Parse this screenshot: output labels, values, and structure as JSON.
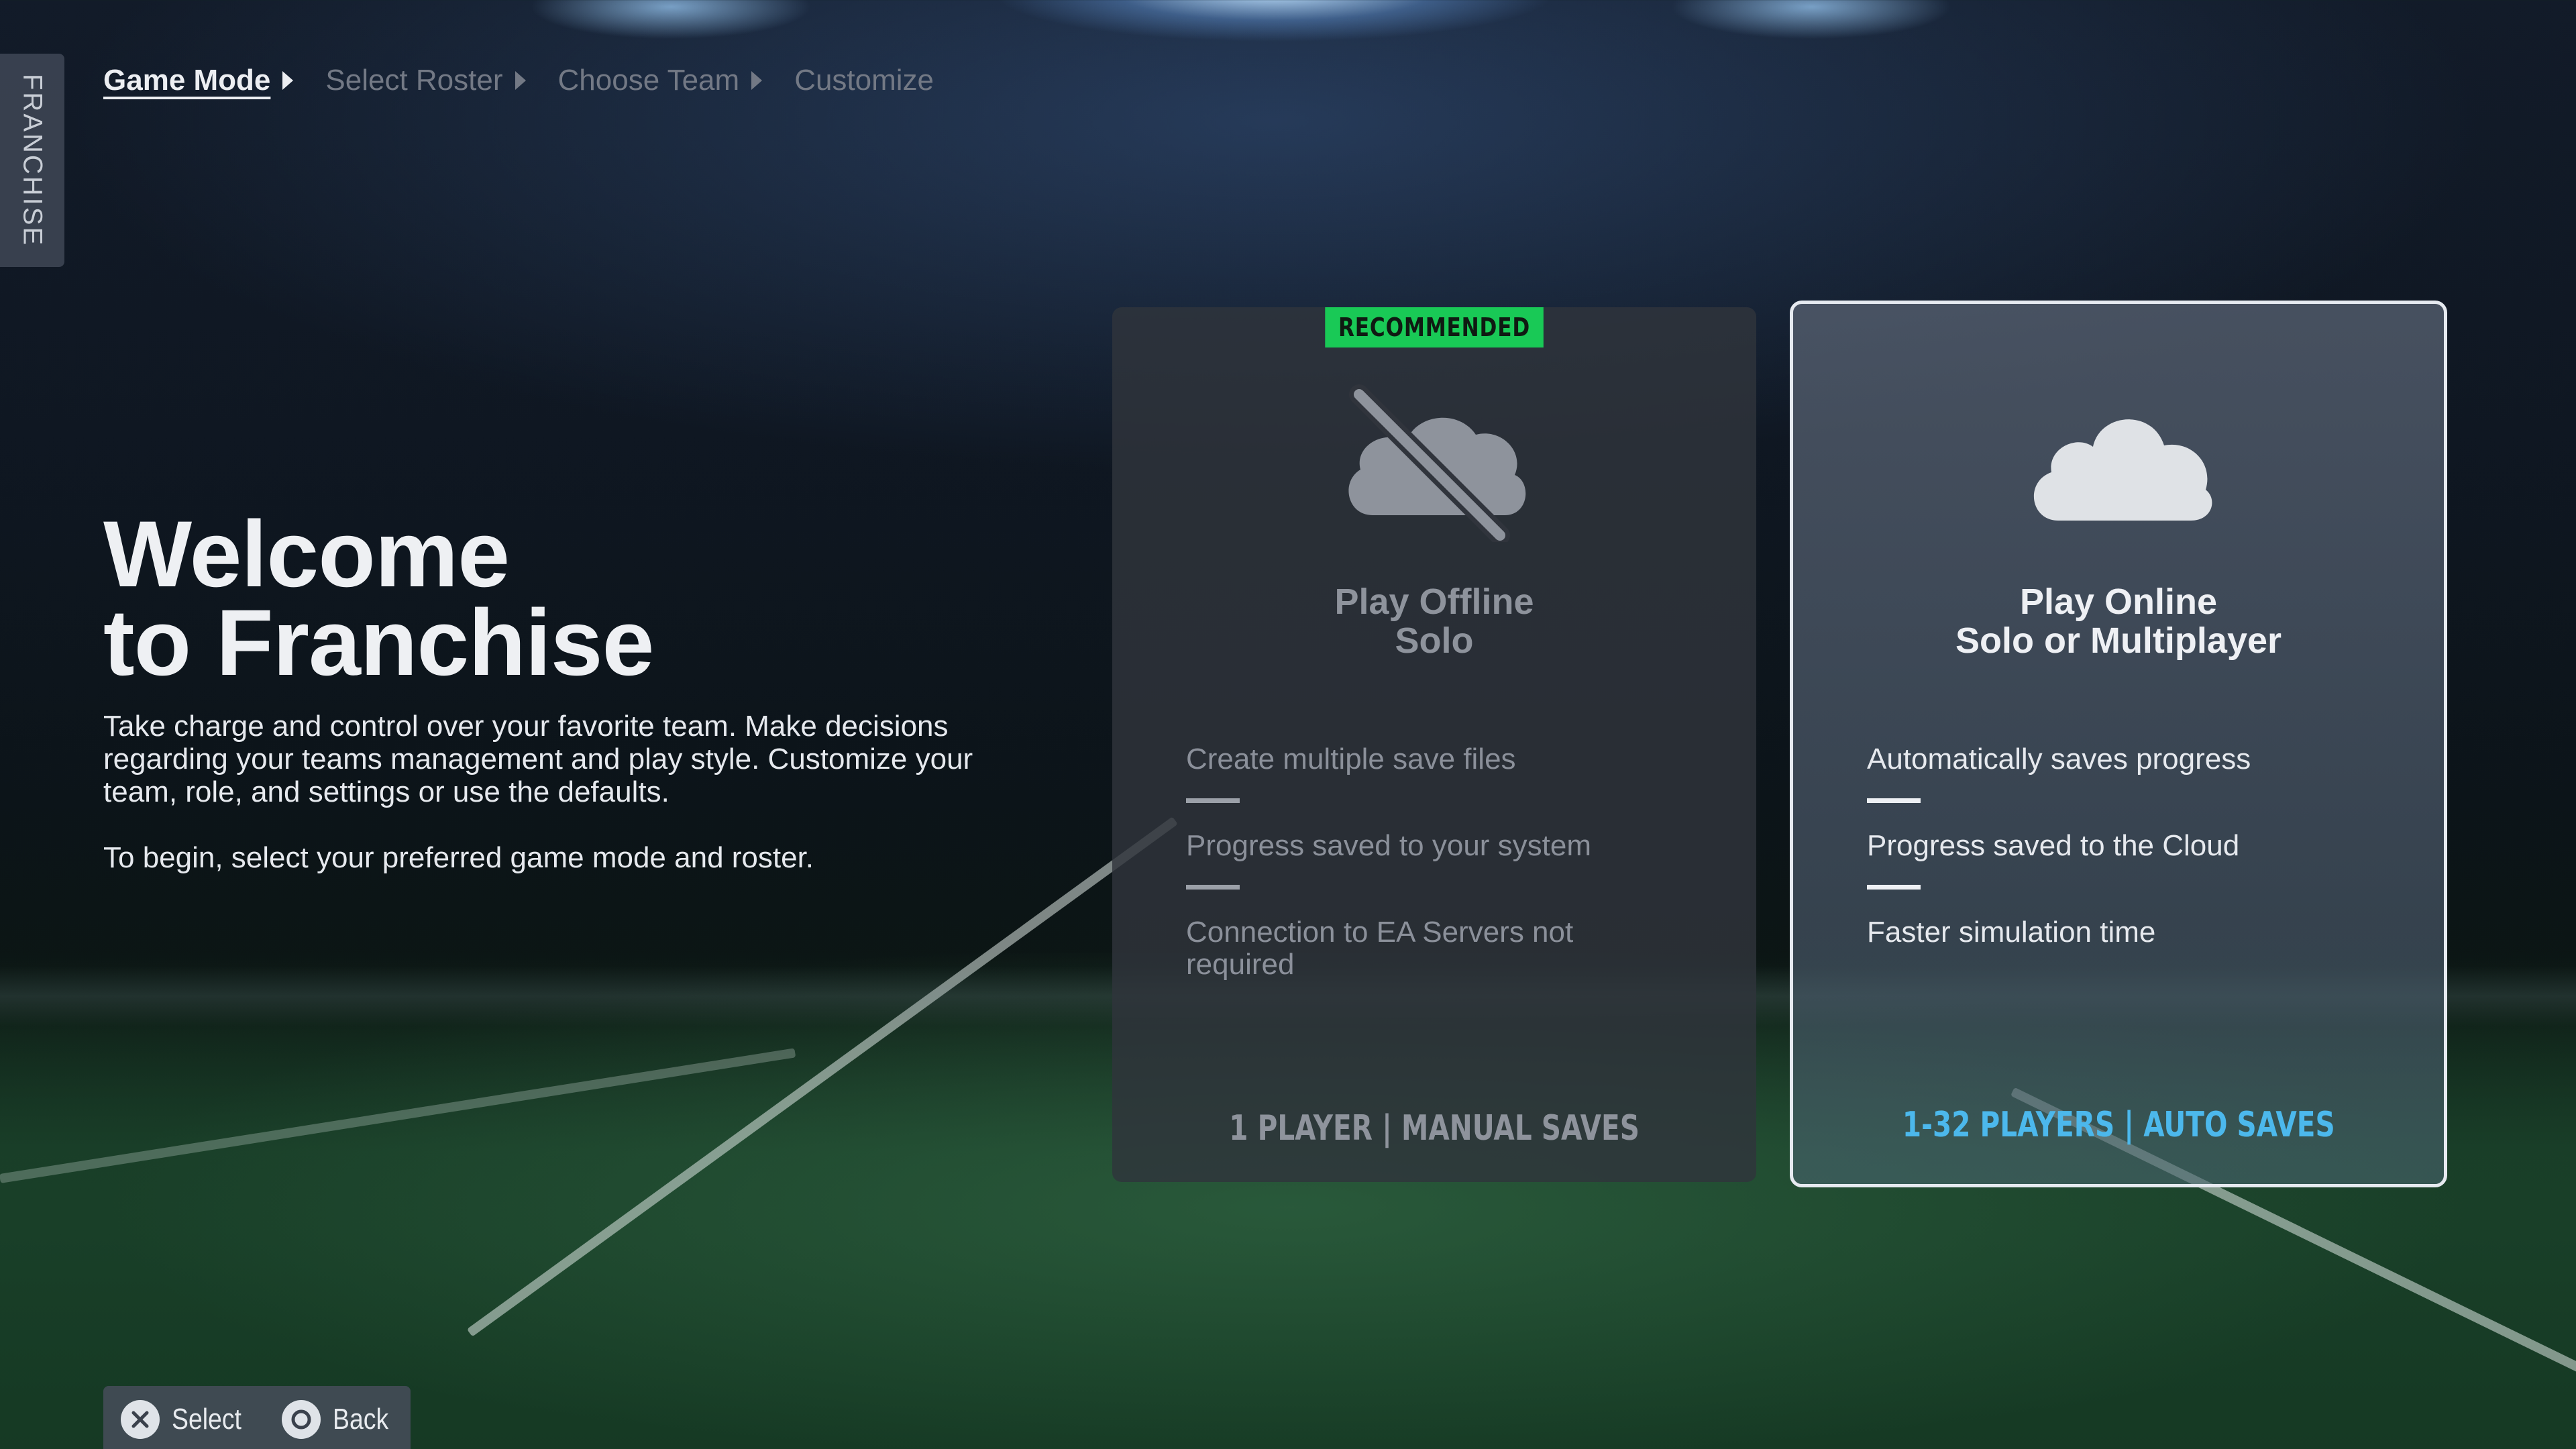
{
  "side_tab": {
    "label": "FRANCHISE"
  },
  "breadcrumb": [
    {
      "label": "Game Mode",
      "active": true
    },
    {
      "label": "Select Roster",
      "active": false
    },
    {
      "label": "Choose Team",
      "active": false
    },
    {
      "label": "Customize",
      "active": false
    }
  ],
  "welcome": {
    "title_line1": "Welcome",
    "title_line2": "to Franchise",
    "body_line1": "Take charge and control over your favorite team. Make decisions regarding your teams management and play style. Customize your team, role, and settings or use the defaults.",
    "body_line2": "To begin, select your preferred game mode and roster."
  },
  "cards": {
    "offline": {
      "badge": "RECOMMENDED",
      "icon": "cloud-offline-icon",
      "title_line1": "Play Offline",
      "title_line2": "Solo",
      "features": [
        "Create multiple save files",
        "Progress saved to your system",
        "Connection to EA Servers not required"
      ],
      "footer": "1 PLAYER | MANUAL SAVES",
      "selected": false
    },
    "online": {
      "icon": "cloud-icon",
      "title_line1": "Play Online",
      "title_line2": "Solo or Multiplayer",
      "features": [
        "Automatically saves progress",
        "Progress saved to the Cloud",
        "Faster simulation time"
      ],
      "footer": "1-32 PLAYERS | AUTO SAVES",
      "selected": true
    }
  },
  "prompts": {
    "select": {
      "icon": "cross-button-icon",
      "label": "Select"
    },
    "back": {
      "icon": "circle-button-icon",
      "label": "Back"
    }
  },
  "colors": {
    "recommended_badge": "#19c956",
    "online_footer": "#4cb8ec",
    "selected_border": "#e6eaf0"
  }
}
